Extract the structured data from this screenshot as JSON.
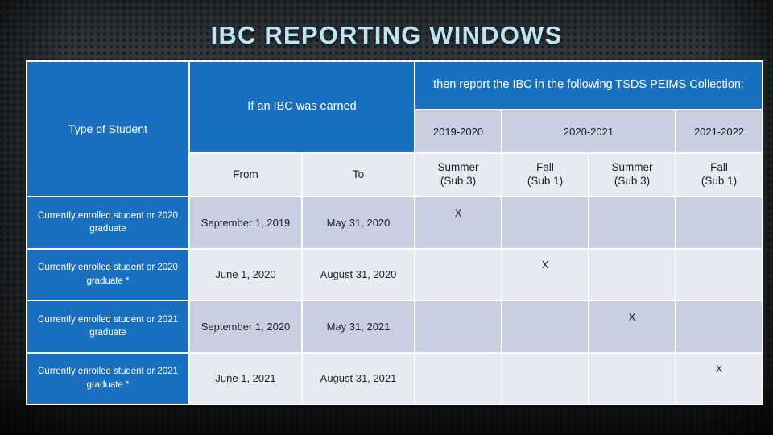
{
  "slide": {
    "title": "IBC REPORTING WINDOWS",
    "title_color": "#bde5f2",
    "background_color": "#2f3438",
    "accent_blue": "#1a70c0",
    "row_dark": "#c9cee0",
    "row_light": "#e7eaf2"
  },
  "table": {
    "headers": {
      "earned_group": "If an IBC was earned",
      "report_group": "then report the IBC in the following TSDS PEIMS Collection:",
      "type_of_student": "Type of Student",
      "from": "From",
      "to": "To",
      "years": [
        {
          "label": "2019-2020",
          "span": 1
        },
        {
          "label": "2020-2021",
          "span": 2
        },
        {
          "label": "2021-2022",
          "span": 1
        }
      ],
      "collections": [
        {
          "season": "Summer",
          "sub": "(Sub 3)"
        },
        {
          "season": "Fall",
          "sub": "(Sub 1)"
        },
        {
          "season": "Summer",
          "sub": "(Sub 3)"
        },
        {
          "season": "Fall",
          "sub": "(Sub 1)"
        }
      ]
    },
    "mark": "X",
    "rows": [
      {
        "type": "Currently enrolled student or 2020 graduate",
        "from": "September 1, 2019",
        "to": "May 31, 2020",
        "marks": [
          "X",
          "",
          "",
          ""
        ],
        "shade": "dark"
      },
      {
        "type": "Currently enrolled student or 2020 graduate *",
        "from": "June 1, 2020",
        "to": "August 31, 2020",
        "marks": [
          "",
          "X",
          "",
          ""
        ],
        "shade": "light"
      },
      {
        "type": "Currently enrolled student or 2021 graduate",
        "from": "September 1, 2020",
        "to": "May 31, 2021",
        "marks": [
          "",
          "",
          "X",
          ""
        ],
        "shade": "dark"
      },
      {
        "type": "Currently enrolled student or 2021 graduate *",
        "from": "June 1, 2021",
        "to": "August 31, 2021",
        "marks": [
          "",
          "",
          "",
          "X"
        ],
        "shade": "light"
      }
    ]
  }
}
